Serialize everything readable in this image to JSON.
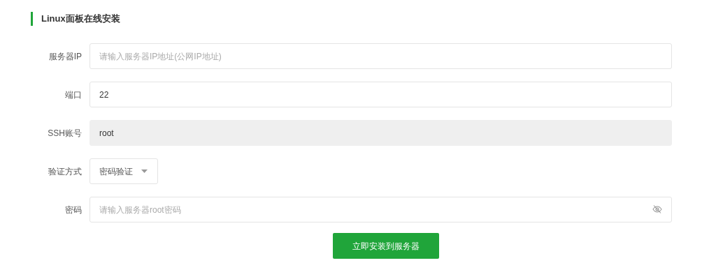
{
  "title": "Linux面板在线安装",
  "fields": [
    {
      "label": "服务器IP",
      "kind": "text",
      "placeholder": "请输入服务器IP地址(公网IP地址)",
      "disabled": false
    },
    {
      "label": "端口",
      "kind": "text",
      "value": "22",
      "disabled": false
    },
    {
      "label": "SSH账号",
      "kind": "text",
      "value": "root",
      "disabled": true
    },
    {
      "label": "验证方式",
      "kind": "select",
      "value": "密码验证",
      "disabled": false
    },
    {
      "label": "密码",
      "kind": "password",
      "placeholder": "请输入服务器root密码",
      "disabled": false
    }
  ],
  "submit": "立即安装到服务器"
}
